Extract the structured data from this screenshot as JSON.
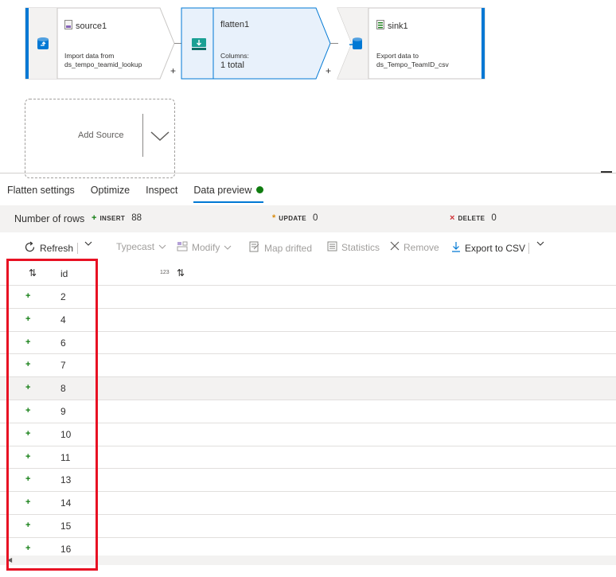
{
  "pipeline": {
    "source": {
      "title": "source1",
      "desc_line1": "Import data from",
      "desc_line2": "ds_tempo_teamid_lookup"
    },
    "flatten": {
      "title": "flatten1",
      "desc_line1": "Columns:",
      "desc_line2": "1 total"
    },
    "sink": {
      "title": "sink1",
      "desc_line1": "Export data to",
      "desc_line2": "ds_Tempo_TeamID_csv"
    },
    "plus": "+",
    "add_source_label": "Add Source"
  },
  "tabs": [
    {
      "label": "Flatten settings"
    },
    {
      "label": "Optimize"
    },
    {
      "label": "Inspect"
    },
    {
      "label": "Data preview"
    }
  ],
  "summary": {
    "rows_label": "Number of rows",
    "insert_mark": "+",
    "insert_label": "INSERT",
    "insert_count": "88",
    "update_mark": "*",
    "update_label": "UPDATE",
    "update_count": "0",
    "delete_mark": "×",
    "delete_label": "DELETE",
    "delete_count": "0"
  },
  "toolbar": {
    "refresh": "Refresh",
    "typecast": "Typecast",
    "modify": "Modify",
    "map_drifted": "Map drifted",
    "statistics": "Statistics",
    "remove": "Remove",
    "export_csv": "Export to CSV"
  },
  "grid": {
    "sort_glyph": "⇅",
    "column_name": "id",
    "column_type": "123",
    "row_mark": "+",
    "rows": [
      "2",
      "4",
      "6",
      "7",
      "8",
      "9",
      "10",
      "11",
      "13",
      "14",
      "15",
      "16"
    ],
    "highlighted_row_index": 4
  },
  "colors": {
    "accent": "#0078d4",
    "insert": "#107c10",
    "update": "#d98a0b",
    "delete": "#d13438",
    "annotation": "#e81123"
  }
}
